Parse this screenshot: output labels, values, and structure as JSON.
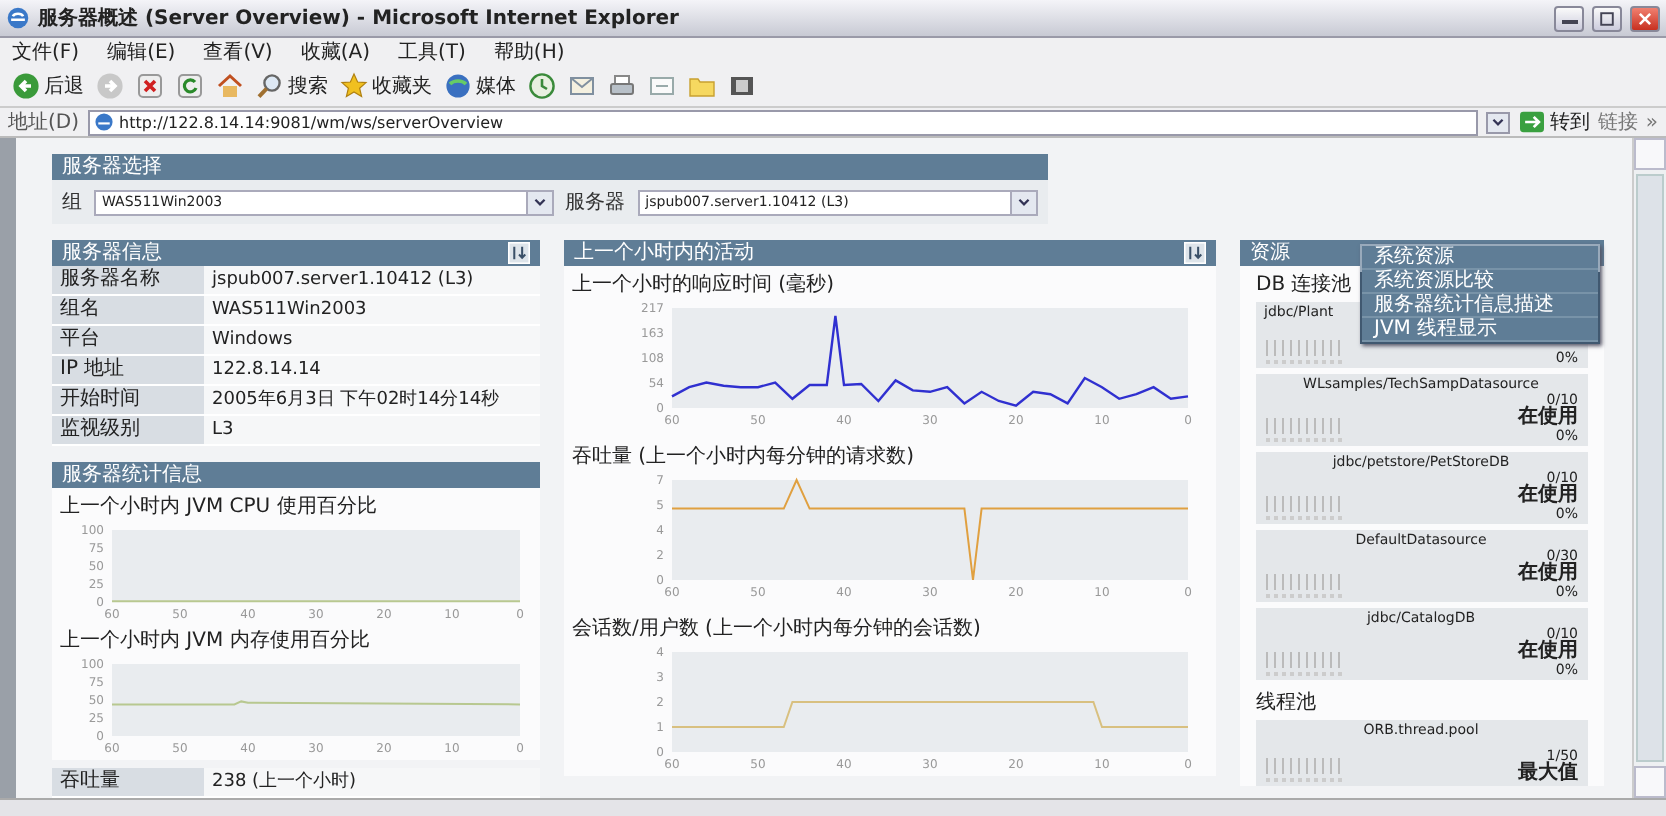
{
  "window": {
    "title": "服务器概述 (Server Overview) - Microsoft Internet Explorer"
  },
  "menu": [
    "文件(F)",
    "编辑(E)",
    "查看(V)",
    "收藏(A)",
    "工具(T)",
    "帮助(H)"
  ],
  "toolbar": [
    {
      "kind": "back",
      "label": "后退"
    },
    {
      "kind": "forward"
    },
    {
      "kind": "stop"
    },
    {
      "kind": "refresh"
    },
    {
      "kind": "home"
    },
    {
      "kind": "search",
      "label": "搜索"
    },
    {
      "kind": "favorites",
      "label": "收藏夹"
    },
    {
      "kind": "media",
      "label": "媒体"
    },
    {
      "kind": "history"
    },
    {
      "kind": "mail"
    },
    {
      "kind": "print"
    },
    {
      "kind": "edit"
    },
    {
      "kind": "folder"
    },
    {
      "kind": "film"
    }
  ],
  "address_bar": {
    "label": "地址(D)",
    "value": "http://122.8.14.14:9081/wm/ws/serverOverview",
    "go": "转到",
    "links": "链接",
    "more": "»"
  },
  "server_selection": {
    "title": "服务器选择",
    "group_label": "组",
    "group_value": "WAS511Win2003",
    "server_label": "服务器",
    "server_value": "jspub007.server1.10412 (L3)"
  },
  "server_info": {
    "title": "服务器信息",
    "rows": [
      {
        "label": "服务器名称",
        "value": "jspub007.server1.10412 (L3)"
      },
      {
        "label": "组名",
        "value": "WAS511Win2003"
      },
      {
        "label": "平台",
        "value": "Windows"
      },
      {
        "label": "IP 地址",
        "value": "122.8.14.14"
      },
      {
        "label": "开始时间",
        "value": "2005年6月3日 下午02时14分14秒"
      },
      {
        "label": "监视级别",
        "value": "L3"
      }
    ]
  },
  "server_stats": {
    "title": "服务器统计信息",
    "charts": [
      {
        "title": "上一个小时内 JVM CPU 使用百分比",
        "chart_data": {
          "type": "line",
          "x": [
            60,
            0
          ],
          "series": [
            {
              "color": "#b8c890",
              "values": [
                1,
                1
              ]
            }
          ],
          "xlim": [
            60,
            0
          ],
          "ylim": [
            0,
            100
          ],
          "xticks": [
            60,
            50,
            40,
            30,
            20,
            10,
            0
          ],
          "yticks": [
            0,
            25,
            50,
            75,
            100
          ]
        }
      },
      {
        "title": "上一个小时内 JVM 内存使用百分比",
        "chart_data": {
          "type": "line",
          "x": [
            60,
            42,
            41,
            40,
            0
          ],
          "series": [
            {
              "color": "#b8c890",
              "values": [
                44,
                44,
                48,
                46,
                44
              ]
            }
          ],
          "xlim": [
            60,
            0
          ],
          "ylim": [
            0,
            100
          ],
          "xticks": [
            60,
            50,
            40,
            30,
            20,
            10,
            0
          ],
          "yticks": [
            0,
            25,
            50,
            75,
            100
          ]
        }
      }
    ],
    "throughput": {
      "label": "吞吐量",
      "value": "238 (上一个小时)"
    }
  },
  "activity": {
    "title": "上一个小时内的活动",
    "charts": [
      {
        "title": "上一个小时的响应时间 (毫秒)",
        "chart_data": {
          "type": "line",
          "x": [
            60,
            58,
            56,
            54,
            52,
            50,
            48,
            46,
            44,
            43,
            42,
            41,
            40,
            38,
            36,
            34,
            32,
            30,
            28,
            26,
            24,
            22,
            20,
            18,
            16,
            14,
            12,
            10,
            8,
            6,
            4,
            2,
            0
          ],
          "series": [
            {
              "color": "#3030d0",
              "values": [
                25,
                45,
                55,
                48,
                45,
                45,
                55,
                20,
                50,
                50,
                50,
                200,
                50,
                52,
                15,
                60,
                38,
                35,
                45,
                10,
                35,
                15,
                5,
                35,
                30,
                10,
                65,
                45,
                20,
                30,
                45,
                20,
                25
              ]
            }
          ],
          "xlim": [
            60,
            0
          ],
          "ylim": [
            0,
            217
          ],
          "xticks": [
            60,
            50,
            40,
            30,
            20,
            10,
            0
          ],
          "yticks": [
            0,
            54,
            108,
            163,
            217
          ]
        }
      },
      {
        "title": "吞吐量 (上一个小时内每分钟的请求数)",
        "chart_data": {
          "type": "line",
          "x": [
            60,
            47,
            45.5,
            44,
            26,
            25,
            24,
            0
          ],
          "series": [
            {
              "color": "#e0a040",
              "values": [
                5,
                5,
                7,
                5,
                5,
                0,
                5,
                5
              ]
            }
          ],
          "xlim": [
            60,
            0
          ],
          "ylim": [
            0,
            7
          ],
          "xticks": [
            60,
            50,
            40,
            30,
            20,
            10,
            0
          ],
          "yticks": [
            {
              "value": 0,
              "label": "0"
            },
            {
              "value": 1.75,
              "label": "2"
            },
            {
              "value": 3.5,
              "label": "4"
            },
            {
              "value": 5.25,
              "label": "5"
            },
            {
              "value": 7,
              "label": "7"
            }
          ]
        }
      },
      {
        "title": "会话数/用户数 (上一个小时内每分钟的会话数)",
        "chart_data": {
          "type": "line",
          "x": [
            60,
            47,
            46,
            11,
            10,
            0
          ],
          "series": [
            {
              "color": "#d8c080",
              "values": [
                1,
                1,
                2,
                2,
                1,
                1
              ]
            }
          ],
          "xlim": [
            60,
            0
          ],
          "ylim": [
            0,
            4
          ],
          "xticks": [
            60,
            50,
            40,
            30,
            20,
            10,
            0
          ],
          "yticks": [
            0,
            1,
            2,
            3,
            4
          ]
        }
      }
    ]
  },
  "resources": {
    "title": "资源",
    "db_pools_title": "DB 连接池",
    "db_pools": [
      {
        "name": "jdbc/Plant",
        "percent": "0%"
      },
      {
        "name": "WLsamples/TechSampDatasource",
        "usage": "0/10",
        "state": "在使用",
        "percent": "0%"
      },
      {
        "name": "jdbc/petstore/PetStoreDB",
        "usage": "0/10",
        "state": "在使用",
        "percent": "0%"
      },
      {
        "name": "DefaultDatasource",
        "usage": "0/30",
        "state": "在使用",
        "percent": "0%"
      },
      {
        "name": "jdbc/CatalogDB",
        "usage": "0/10",
        "state": "在使用",
        "percent": "0%"
      }
    ],
    "thread_pools_title": "线程池",
    "thread_pools": [
      {
        "name": "ORB.thread.pool",
        "usage": "1/50",
        "state": "最大值"
      }
    ]
  },
  "resource_menu": {
    "items": [
      {
        "label": "系统资源",
        "selected": true
      },
      {
        "label": "系统资源比较",
        "selected": false
      },
      {
        "label": "服务器统计信息描述",
        "selected": false
      },
      {
        "label": "JVM 线程显示",
        "selected": false
      }
    ]
  }
}
